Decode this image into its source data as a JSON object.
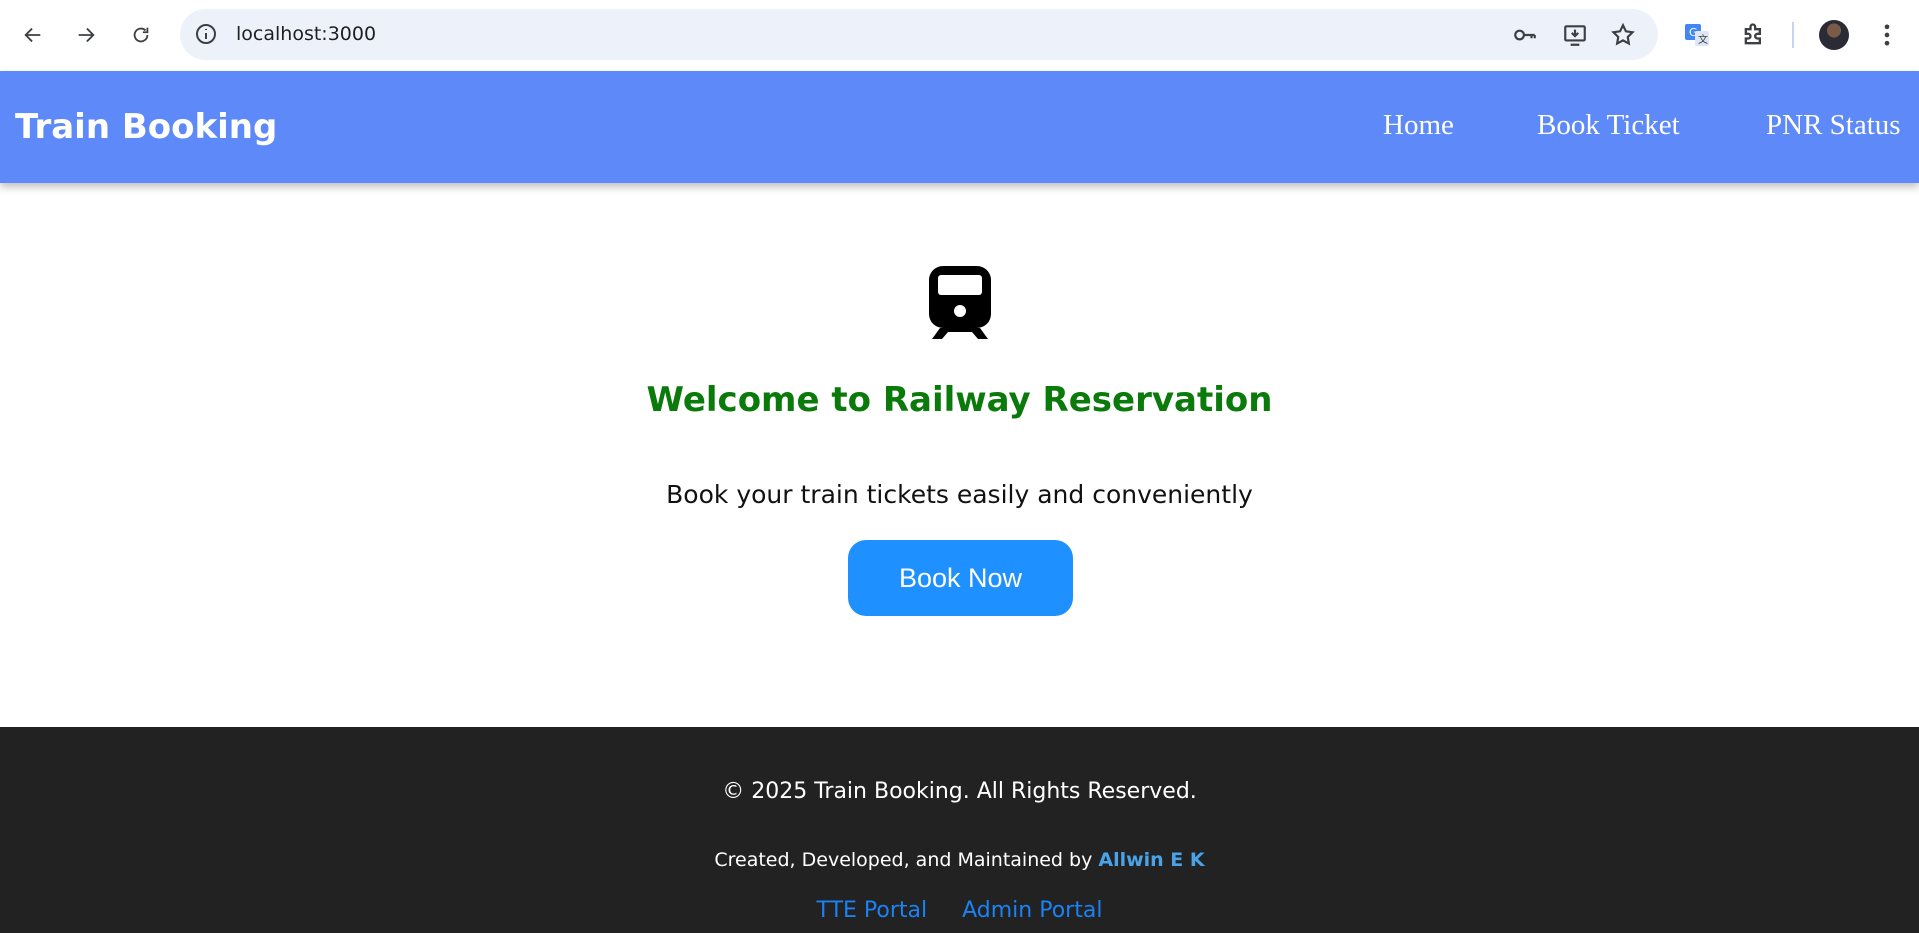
{
  "browser": {
    "url": "localhost:3000",
    "icons": [
      "back-icon",
      "forward-icon",
      "reload-icon",
      "site-info-icon",
      "key-icon",
      "install-app-icon",
      "star-icon",
      "translate-icon",
      "extensions-icon",
      "profile-avatar",
      "more-menu-icon"
    ]
  },
  "header": {
    "brand": "Train Booking",
    "nav": [
      {
        "label": "Home"
      },
      {
        "label": "Book Ticket"
      },
      {
        "label": "PNR Status"
      }
    ],
    "background_color": "#5e89f8"
  },
  "hero": {
    "icon": "train-icon",
    "title": "Welcome to Railway Reservation",
    "title_color": "#0a7a0a",
    "subtitle": "Book your train tickets easily and conveniently",
    "cta_label": "Book Now",
    "cta_color": "#1e90ff"
  },
  "footer": {
    "copyright": "© 2025 Train Booking. All Rights Reserved.",
    "credits_prefix": "Created, Developed, and Maintained by",
    "author": "Allwin E K",
    "links": [
      {
        "label": "TTE Portal"
      },
      {
        "label": "Admin Portal"
      }
    ],
    "background_color": "#222222"
  }
}
